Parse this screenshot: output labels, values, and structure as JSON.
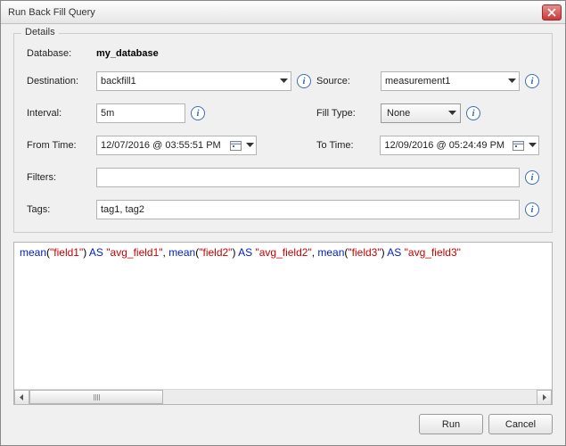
{
  "window": {
    "title": "Run Back Fill Query"
  },
  "group": {
    "legend": "Details"
  },
  "labels": {
    "database": "Database:",
    "destination": "Destination:",
    "source": "Source:",
    "interval": "Interval:",
    "fillType": "Fill Type:",
    "fromTime": "From Time:",
    "toTime": "To Time:",
    "filters": "Filters:",
    "tags": "Tags:"
  },
  "values": {
    "database": "my_database",
    "destination": "backfill1",
    "source": "measurement1",
    "interval": "5m",
    "fillType": "None",
    "fromTime": "12/07/2016 @ 03:55:51 PM",
    "toTime": "12/09/2016 @ 05:24:49 PM",
    "filters": "",
    "tags": "tag1, tag2"
  },
  "query": {
    "tokens": [
      {
        "t": "mean",
        "c": "blue"
      },
      {
        "t": "(",
        "c": ""
      },
      {
        "t": "\"field1\"",
        "c": "red"
      },
      {
        "t": ") ",
        "c": ""
      },
      {
        "t": "AS",
        "c": "blue"
      },
      {
        "t": " ",
        "c": ""
      },
      {
        "t": "\"avg_field1\"",
        "c": "red"
      },
      {
        "t": ", ",
        "c": ""
      },
      {
        "t": "mean",
        "c": "blue"
      },
      {
        "t": "(",
        "c": ""
      },
      {
        "t": "\"field2\"",
        "c": "red"
      },
      {
        "t": ") ",
        "c": ""
      },
      {
        "t": "AS",
        "c": "blue"
      },
      {
        "t": " ",
        "c": ""
      },
      {
        "t": "\"avg_field2\"",
        "c": "red"
      },
      {
        "t": ", ",
        "c": ""
      },
      {
        "t": "mean",
        "c": "blue"
      },
      {
        "t": "(",
        "c": ""
      },
      {
        "t": "\"field3\"",
        "c": "red"
      },
      {
        "t": ") ",
        "c": ""
      },
      {
        "t": "AS",
        "c": "blue"
      },
      {
        "t": " ",
        "c": ""
      },
      {
        "t": "\"avg_field3\"",
        "c": "red"
      }
    ]
  },
  "buttons": {
    "run": "Run",
    "cancel": "Cancel"
  }
}
